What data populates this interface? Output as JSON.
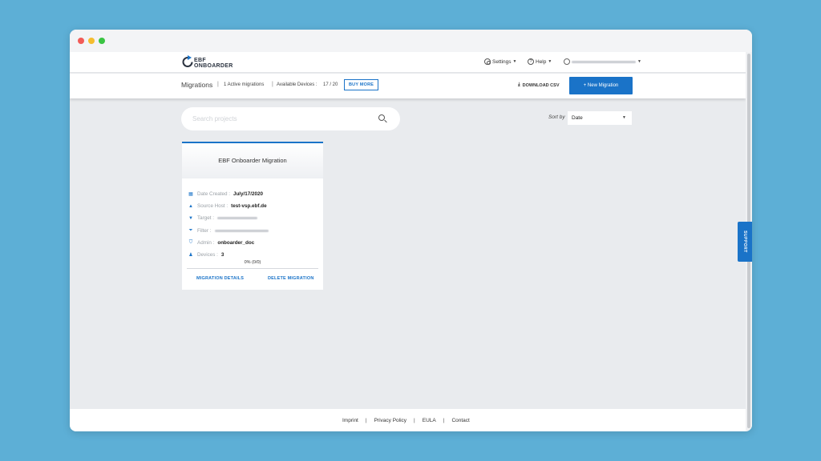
{
  "brand": {
    "line1": "EBF",
    "line2": "ONBOARDER"
  },
  "topnav": {
    "settings": "Settings",
    "help": "Help"
  },
  "subbar": {
    "title": "Migrations",
    "active": "1 Active migrations",
    "devices_label": "Available Devices :",
    "devices_value": "17 / 20",
    "buy_more": "BUY MORE",
    "download": "DOWNLOAD CSV",
    "new_migration": "+ New Migration"
  },
  "search": {
    "placeholder": "Search projects"
  },
  "sort": {
    "label": "Sort by",
    "value": "Date"
  },
  "card": {
    "title": "EBF Onboarder Migration",
    "rows": [
      {
        "icon": "calendar-icon",
        "label": "Date Created :",
        "value": "July/17/2020"
      },
      {
        "icon": "source-up-icon",
        "label": "Source Host :",
        "value": "test-vsp.ebf.de"
      },
      {
        "icon": "target-down-icon",
        "label": "Target :",
        "value": ""
      },
      {
        "icon": "filter-icon",
        "label": "Filter :",
        "value": ""
      },
      {
        "icon": "shield-icon",
        "label": "Admin :",
        "value": "onboarder_doc"
      },
      {
        "icon": "devices-icon",
        "label": "Devices :",
        "value": "3"
      }
    ],
    "progress": "0% (0/0)",
    "details_link": "MIGRATION DETAILS",
    "delete_link": "DELETE MIGRATION"
  },
  "footer": {
    "links": [
      "Imprint",
      "Privacy Policy",
      "EULA",
      "Contact"
    ]
  },
  "support": "SUPPORT",
  "colors": {
    "accent": "#1a73c8",
    "background": "#5dafd6",
    "page": "#e9ebee"
  }
}
